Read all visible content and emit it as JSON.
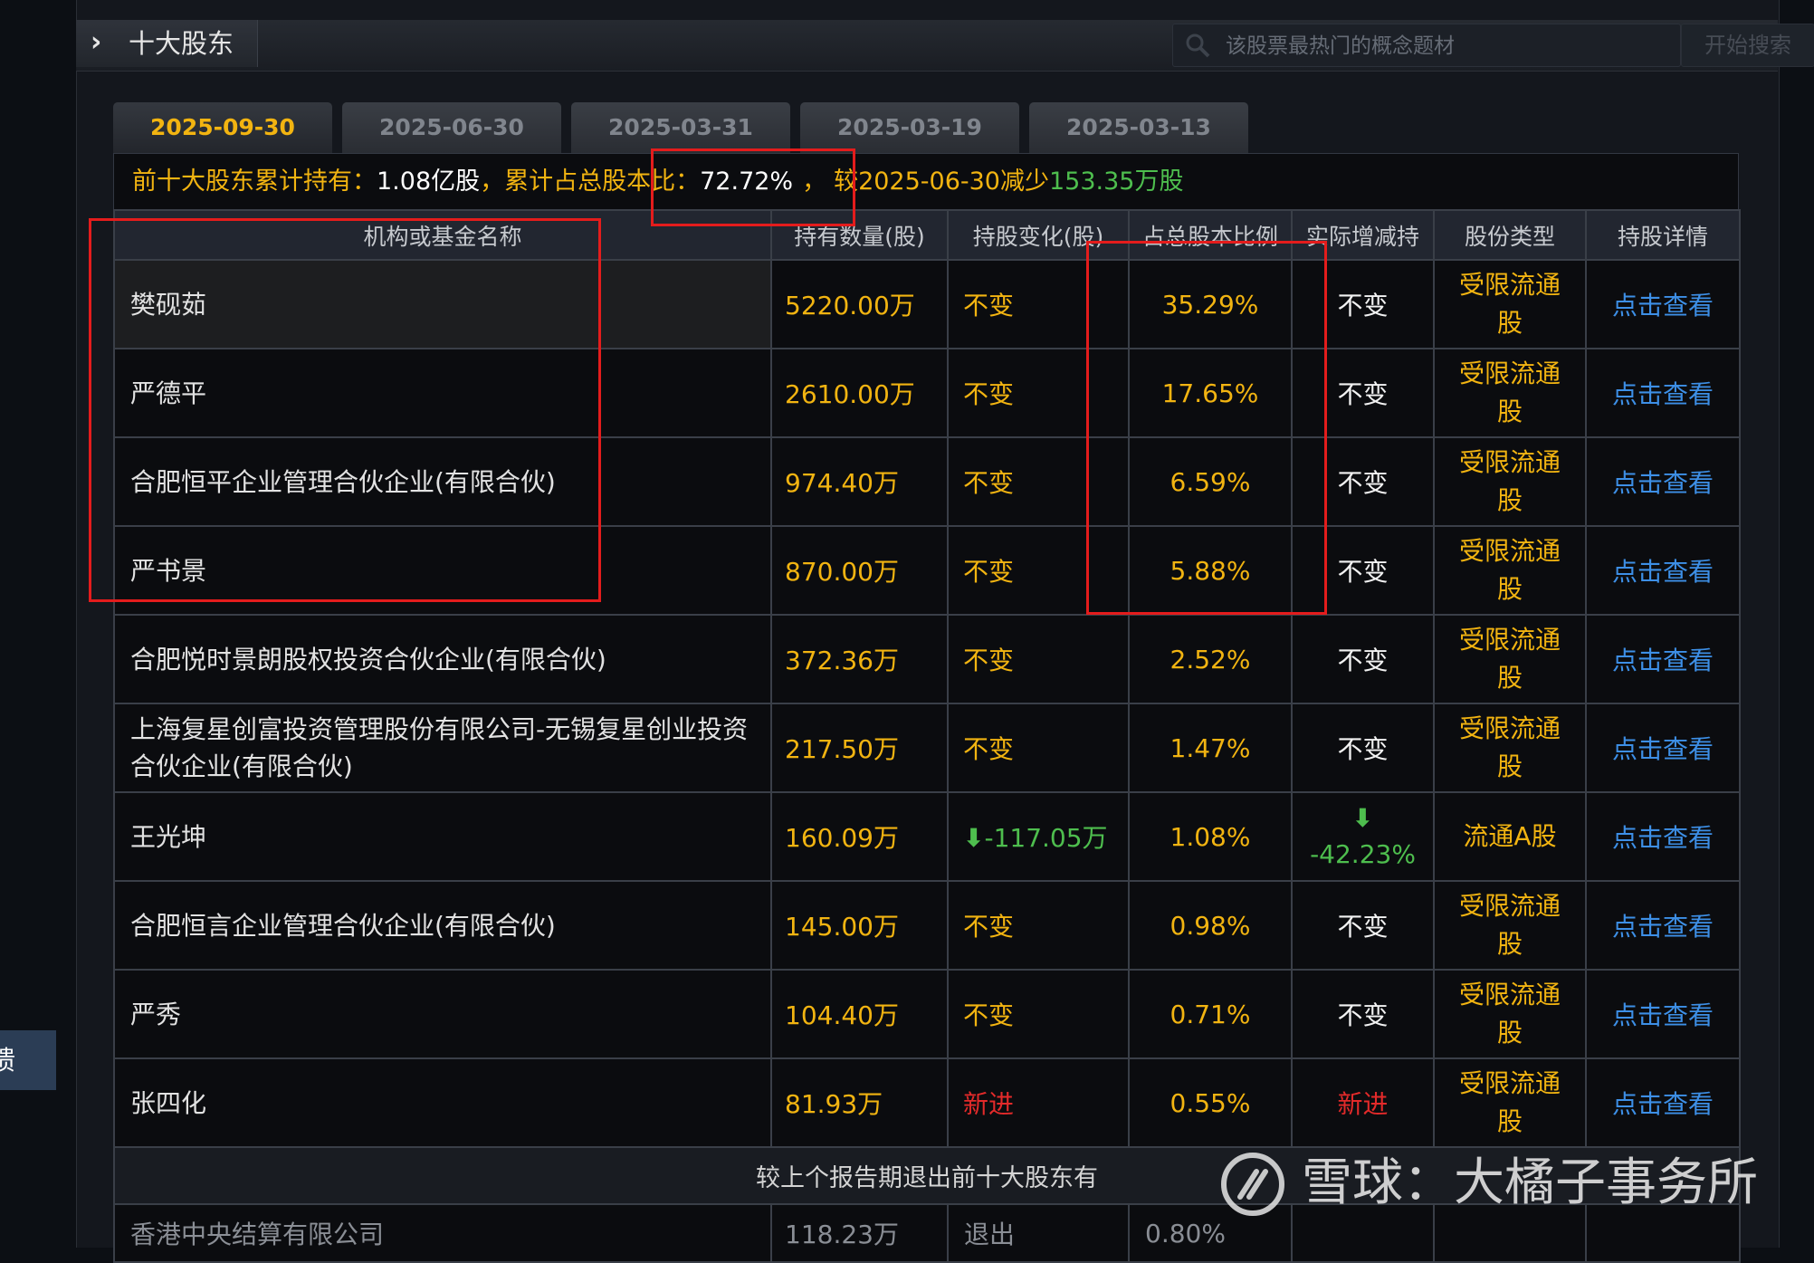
{
  "header": {
    "title": "十大股东",
    "search_placeholder": "该股票最热门的概念题材",
    "search_button": "开始搜索",
    "help": "?"
  },
  "tabs": [
    "2025-09-30",
    "2025-06-30",
    "2025-03-31",
    "2025-03-19",
    "2025-03-13"
  ],
  "active_tab": 0,
  "summary": {
    "label": "前十大股东累计持有：",
    "total": "1.08亿股",
    "ratio_label": "，累计占总股本比：",
    "ratio": "72.72%",
    "sep": "，",
    "compare_text": "较2025-06-30减少",
    "change": "153.35万股"
  },
  "columns": [
    "机构或基金名称",
    "持有数量(股)",
    "持股变化(股)",
    "占总股本比例",
    "实际增减持",
    "股份类型",
    "持股详情"
  ],
  "rows": [
    {
      "name": "樊砚茹",
      "shares": "5220.00万",
      "change": "不变",
      "ratio": "35.29%",
      "actual": "不变",
      "type": "受限流通股",
      "detail": "点击查看"
    },
    {
      "name": "严德平",
      "shares": "2610.00万",
      "change": "不变",
      "ratio": "17.65%",
      "actual": "不变",
      "type": "受限流通股",
      "detail": "点击查看"
    },
    {
      "name": "合肥恒平企业管理合伙企业(有限合伙)",
      "shares": "974.40万",
      "change": "不变",
      "ratio": "6.59%",
      "actual": "不变",
      "type": "受限流通股",
      "detail": "点击查看"
    },
    {
      "name": "严书景",
      "shares": "870.00万",
      "change": "不变",
      "ratio": "5.88%",
      "actual": "不变",
      "type": "受限流通股",
      "detail": "点击查看"
    },
    {
      "name": "合肥悦时景朗股权投资合伙企业(有限合伙)",
      "shares": "372.36万",
      "change": "不变",
      "ratio": "2.52%",
      "actual": "不变",
      "type": "受限流通股",
      "detail": "点击查看"
    },
    {
      "name": "上海复星创富投资管理股份有限公司-无锡复星创业投资合伙企业(有限合伙)",
      "shares": "217.50万",
      "change": "不变",
      "ratio": "1.47%",
      "actual": "不变",
      "type": "受限流通股",
      "detail": "点击查看"
    },
    {
      "name": "王光坤",
      "shares": "160.09万",
      "change": "-117.05万",
      "change_dir": "down",
      "ratio": "1.08%",
      "actual": "-42.23%",
      "actual_dir": "down",
      "type": "流通A股",
      "detail": "点击查看"
    },
    {
      "name": "合肥恒言企业管理合伙企业(有限合伙)",
      "shares": "145.00万",
      "change": "不变",
      "ratio": "0.98%",
      "actual": "不变",
      "type": "受限流通股",
      "detail": "点击查看"
    },
    {
      "name": "严秀",
      "shares": "104.40万",
      "change": "不变",
      "ratio": "0.71%",
      "actual": "不变",
      "type": "受限流通股",
      "detail": "点击查看"
    },
    {
      "name": "张四化",
      "shares": "81.93万",
      "change": "新进",
      "change_dir": "new",
      "ratio": "0.55%",
      "actual": "新进",
      "actual_dir": "new",
      "type": "受限流通股",
      "detail": "点击查看"
    }
  ],
  "exit_section": {
    "title": "较上个报告期退出前十大股东有",
    "rows": [
      {
        "name": "香港中央结算有限公司",
        "shares": "118.23万",
        "change": "退出",
        "ratio": "0.80%"
      }
    ]
  },
  "watermark": "雪球：大橘子事务所",
  "side_tab": "馈",
  "colors": {
    "accent": "#f2b411",
    "link": "#3d8fe6",
    "decrease": "#4ebe4e",
    "new": "#e32a2a",
    "annotation": "#e41c1c"
  }
}
